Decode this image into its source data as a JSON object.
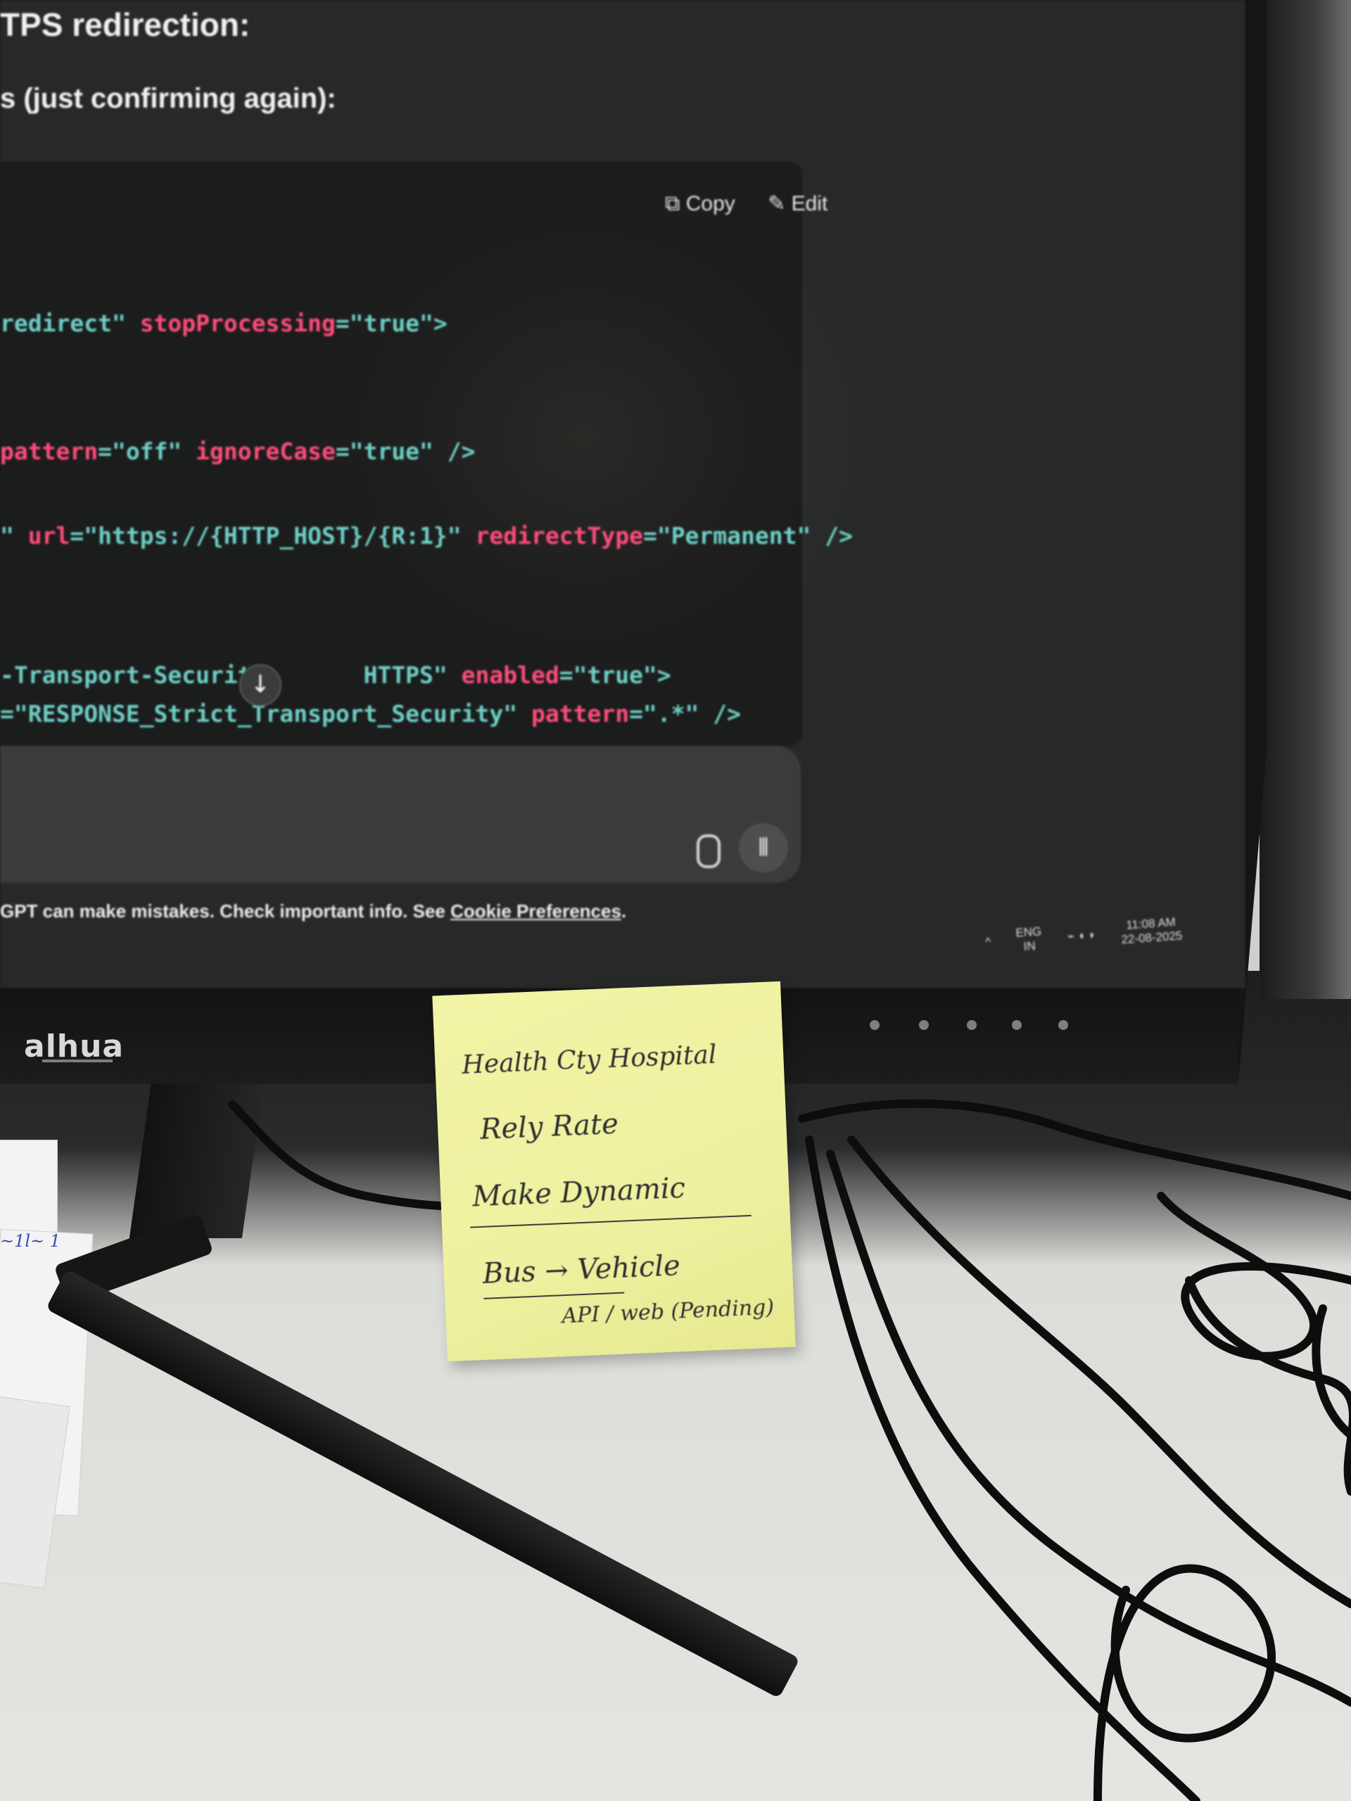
{
  "screen": {
    "heading_1": "TPS redirection:",
    "heading_2": "s (just confirming again):",
    "code_toolbar": {
      "copy_label": "⧉ Copy",
      "edit_label": "✎ Edit"
    },
    "code_lines": [
      {
        "segments": [
          {
            "t": "redirect\" ",
            "c": "str"
          },
          {
            "t": "stopProcessing",
            "c": "attr"
          },
          {
            "t": "=\"true\">",
            "c": "str"
          }
        ]
      },
      {
        "segments": [
          {
            "t": "pattern",
            "c": "attr"
          },
          {
            "t": "=\"off\" ",
            "c": "str"
          },
          {
            "t": "ignoreCase",
            "c": "attr"
          },
          {
            "t": "=\"true\" />",
            "c": "str"
          }
        ]
      },
      {
        "segments": [
          {
            "t": "\" ",
            "c": "str"
          },
          {
            "t": "url",
            "c": "attr"
          },
          {
            "t": "=\"https://{HTTP_HOST}/{R:1}\" ",
            "c": "str"
          },
          {
            "t": "redirectType",
            "c": "attr"
          },
          {
            "t": "=\"Permanent\" />",
            "c": "str"
          }
        ]
      },
      {
        "segments": [
          {
            "t": "-Transport-Security ",
            "c": "str"
          },
          {
            "t": "      HTTPS\" ",
            "c": "str"
          },
          {
            "t": "enabled",
            "c": "attr"
          },
          {
            "t": "=\"true\">",
            "c": "str"
          }
        ]
      },
      {
        "segments": [
          {
            "t": "=\"RESPONSE_Strict_Transport_Security\" ",
            "c": "str"
          },
          {
            "t": "pattern",
            "c": "attr"
          },
          {
            "t": "=\".*\" />",
            "c": "str"
          }
        ]
      }
    ],
    "scroll_down_glyph": "↓",
    "voice_glyph": "⫴",
    "disclaimer_text": "GPT can make mistakes. Check important info. See ",
    "disclaimer_link": "Cookie Preferences",
    "disclaimer_end": ".",
    "taskbar": {
      "chevron": "^",
      "lang_top": "ENG",
      "lang_bottom": "IN",
      "icons": "⌁ ◖ ◗",
      "time": "11:08 AM",
      "date": "22-08-2025"
    }
  },
  "monitor": {
    "brand": "alhua"
  },
  "sticky_note": {
    "lines": [
      "Health Cty Hospital",
      "Rely Rate",
      "Make Dynamic",
      "Bus → Vehicle",
      "API / web (Pending)"
    ]
  },
  "paper_scribble": "~1l~ 1",
  "colors": {
    "code_attr": "#ff4d7a",
    "code_string": "#6ed0c8",
    "sticky": "#eef1a0",
    "screen_bg": "#2f302f"
  }
}
